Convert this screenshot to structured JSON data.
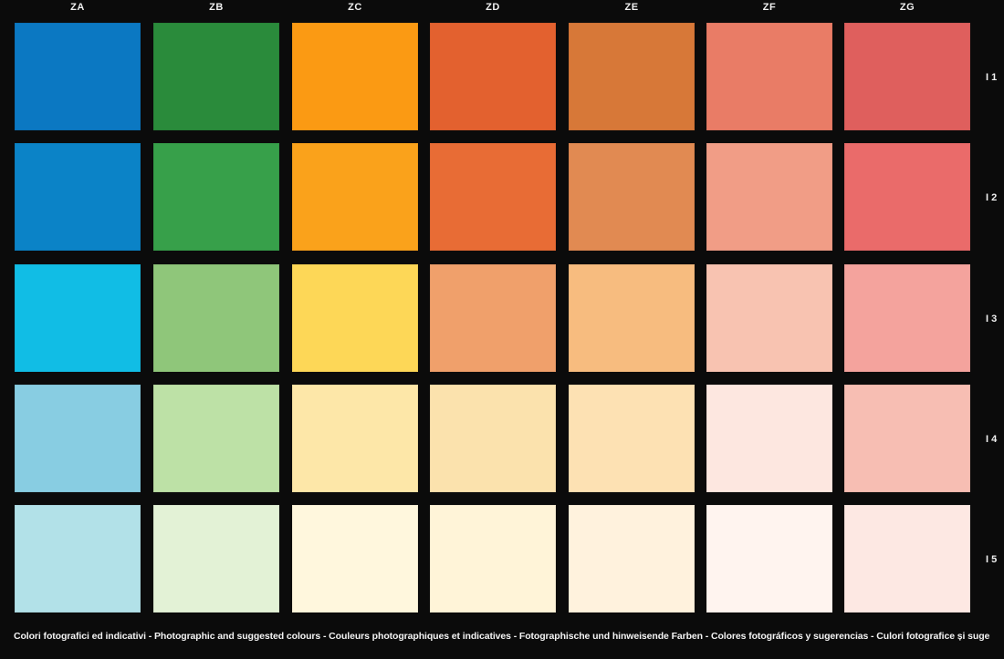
{
  "columns": [
    "ZA",
    "ZB",
    "ZC",
    "ZD",
    "ZE",
    "ZF",
    "ZG"
  ],
  "rows": [
    "I 1",
    "I 2",
    "I 3",
    "I 4",
    "I 5"
  ],
  "swatches": [
    [
      "#0b78c2",
      "#2a8b3b",
      "#fb9a13",
      "#e3612f",
      "#d77838",
      "#e97c66",
      "#df5f5d"
    ],
    [
      "#0b83c7",
      "#37a04a",
      "#faa21b",
      "#e86c35",
      "#e18a52",
      "#f19d86",
      "#ea6b6a"
    ],
    [
      "#11bde5",
      "#8fc67a",
      "#fdd757",
      "#f0a06b",
      "#f7bc7f",
      "#f8c3b1",
      "#f4a39d"
    ],
    [
      "#88cde2",
      "#bde1a6",
      "#fde7a8",
      "#fbe2ad",
      "#fde1b3",
      "#fde7e0",
      "#f7beb3"
    ],
    [
      "#b2e1e8",
      "#e3f2d6",
      "#fff7dd",
      "#fff4d8",
      "#fff2dd",
      "#fff4ef",
      "#fde8e3"
    ]
  ],
  "footer": {
    "text": "Colori fotografici ed indicativi - Photographic and suggested colours - Couleurs photographiques et indicatives - Fotographische und hinweisende Farben - Colores fotográficos y sugerencias - Culori fotografice și sugerate - Φωτογραφικά και προτεινόμενα χρώματα."
  }
}
